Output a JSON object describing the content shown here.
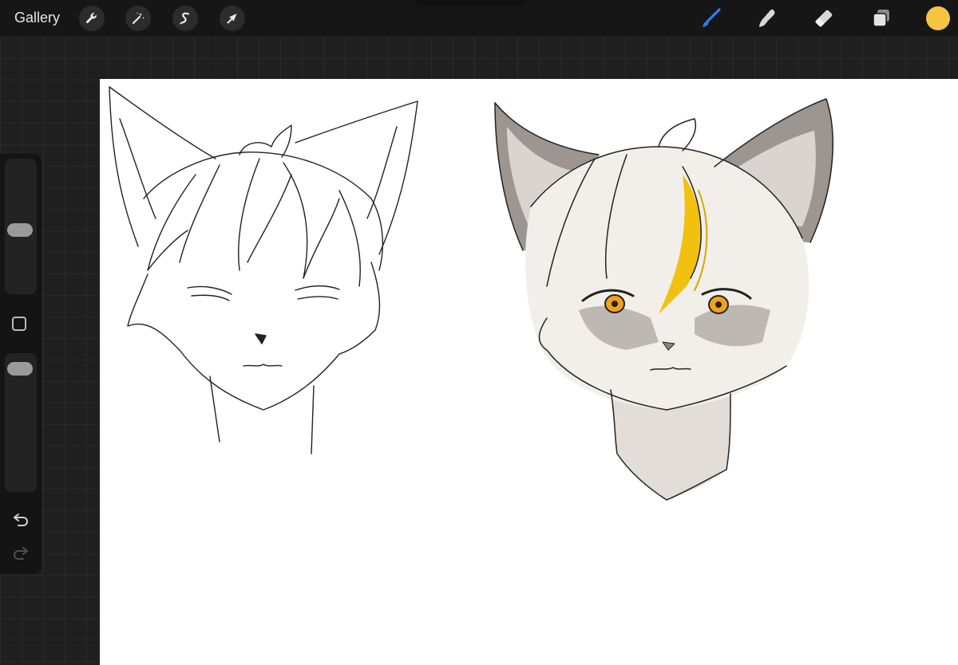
{
  "toolbar": {
    "gallery_label": "Gallery",
    "left_tools": [
      {
        "name": "actions",
        "icon": "wrench-icon"
      },
      {
        "name": "adjustments",
        "icon": "magic-wand-icon"
      },
      {
        "name": "selection",
        "icon": "selection-s-icon"
      },
      {
        "name": "transform",
        "icon": "arrow-cursor-icon"
      }
    ],
    "right_tools": [
      {
        "name": "brush",
        "icon": "brush-icon",
        "active": true
      },
      {
        "name": "smudge",
        "icon": "smudge-icon"
      },
      {
        "name": "eraser",
        "icon": "eraser-icon"
      },
      {
        "name": "layers",
        "icon": "layers-icon"
      }
    ],
    "active_color": "#f5c542",
    "active_tool_color": "#2f7cf6"
  },
  "sidebar": {
    "brush_size_level": 0.47,
    "opacity_level": 0.05,
    "modifier_icon": "square-modifier-icon",
    "undo_icon": "undo-icon",
    "redo_icon": "redo-icon"
  },
  "canvas": {
    "background": "#ffffff",
    "artworks": [
      {
        "name": "sketch-cat-boy",
        "style": "line-art"
      },
      {
        "name": "colored-cat-boy",
        "accent_color": "#f2c10f",
        "eye_color": "#f0a21a"
      }
    ]
  }
}
